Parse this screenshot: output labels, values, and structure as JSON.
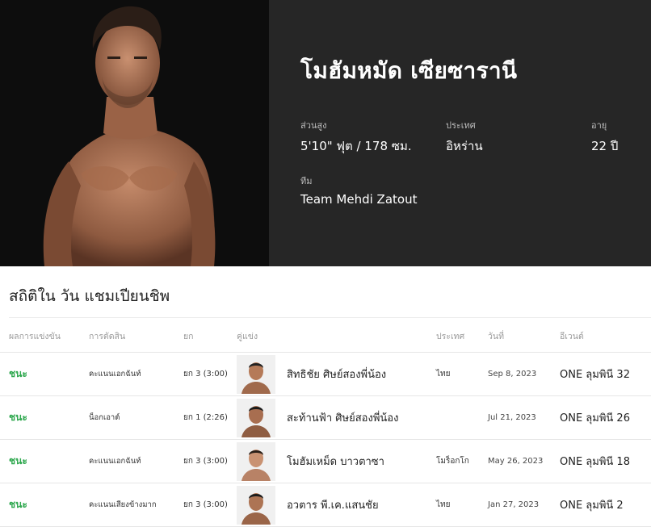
{
  "athlete": {
    "name": "โมฮัมหมัด เซียซารานี",
    "height_label": "ส่วนสูง",
    "height_value": "5'10\" ฟุต / 178 ซม.",
    "country_label": "ประเทศ",
    "country_value": "อิหร่าน",
    "age_label": "อายุ",
    "age_value": "22 ปี",
    "team_label": "ทีม",
    "team_value": "Team Mehdi Zatout"
  },
  "stats": {
    "title": "สถิติใน วัน แชมเปียนชิพ",
    "columns": {
      "result": "ผลการแข่งขัน",
      "method": "การตัดสิน",
      "round": "ยก",
      "opponent": "คู่แข่ง",
      "country": "ประเทศ",
      "date": "วันที่",
      "event": "อีเวนต์"
    },
    "rows": [
      {
        "result": "ชนะ",
        "method": "คะแนนเอกฉันท์",
        "round": "ยก 3 (3:00)",
        "opponent": "สิทธิชัย ศิษย์สองพี่น้อง",
        "country": "ไทย",
        "date": "Sep 8, 2023",
        "event": "ONE ลุมพินี 32"
      },
      {
        "result": "ชนะ",
        "method": "น็อกเอาต์",
        "round": "ยก 1 (2:26)",
        "opponent": "สะท้านฟ้า ศิษย์สองพี่น้อง",
        "country": "",
        "date": "Jul 21, 2023",
        "event": "ONE ลุมพินี 26"
      },
      {
        "result": "ชนะ",
        "method": "คะแนนเอกฉันท์",
        "round": "ยก 3 (3:00)",
        "opponent": "โมฮัมเหม็ด บาวตาซา",
        "country": "โมร็อกโก",
        "date": "May 26, 2023",
        "event": "ONE ลุมพินี 18"
      },
      {
        "result": "ชนะ",
        "method": "คะแนนเสียงข้างมาก",
        "round": "ยก 3 (3:00)",
        "opponent": "อวตาร พี.เค.แสนชัย",
        "country": "ไทย",
        "date": "Jan 27, 2023",
        "event": "ONE ลุมพินี 2"
      }
    ]
  },
  "colors": {
    "win": "#2fa84f",
    "hero_dark": "#262626",
    "photo_bg": "#0d0d0d"
  }
}
